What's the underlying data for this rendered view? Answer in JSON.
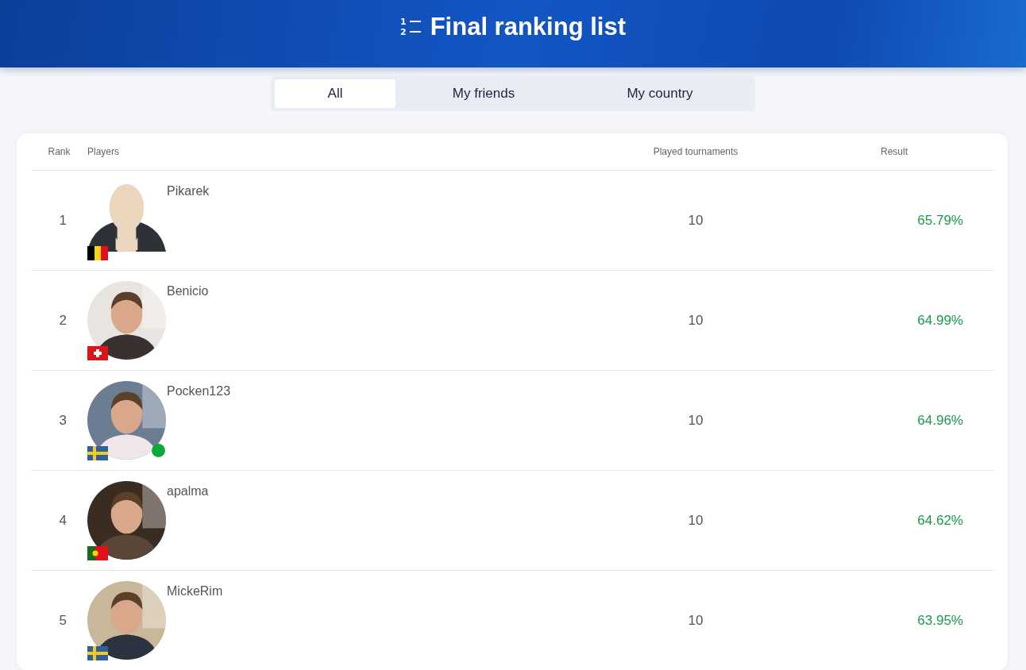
{
  "header": {
    "title": "Final ranking list",
    "icon_numbers": [
      "1",
      "2"
    ]
  },
  "tabs": [
    {
      "label": "All",
      "selected": true
    },
    {
      "label": "My friends",
      "selected": false
    },
    {
      "label": "My country",
      "selected": false
    }
  ],
  "table": {
    "columns": [
      "Rank",
      "Players",
      "Played tournaments",
      "Result"
    ],
    "rows": [
      {
        "rank": "1",
        "name": "Pikarek",
        "avatar": {
          "kind": "default"
        },
        "flag": {
          "kind": "belgium"
        },
        "online": false,
        "played": "10",
        "result": "65.79%"
      },
      {
        "rank": "2",
        "name": "Benicio",
        "flag": {
          "kind": "switzerland"
        },
        "online": false,
        "played": "10",
        "result": "64.99%"
      },
      {
        "rank": "3",
        "name": "Pocken123",
        "flag": {
          "kind": "sweden"
        },
        "online": true,
        "played": "10",
        "result": "64.96%"
      },
      {
        "rank": "4",
        "name": "apalma",
        "flag": {
          "kind": "portugal"
        },
        "online": false,
        "played": "10",
        "result": "64.62%"
      },
      {
        "rank": "5",
        "name": "MickeRim",
        "flag": {
          "kind": "sweden"
        },
        "online": false,
        "played": "10",
        "result": "63.95%"
      }
    ]
  }
}
